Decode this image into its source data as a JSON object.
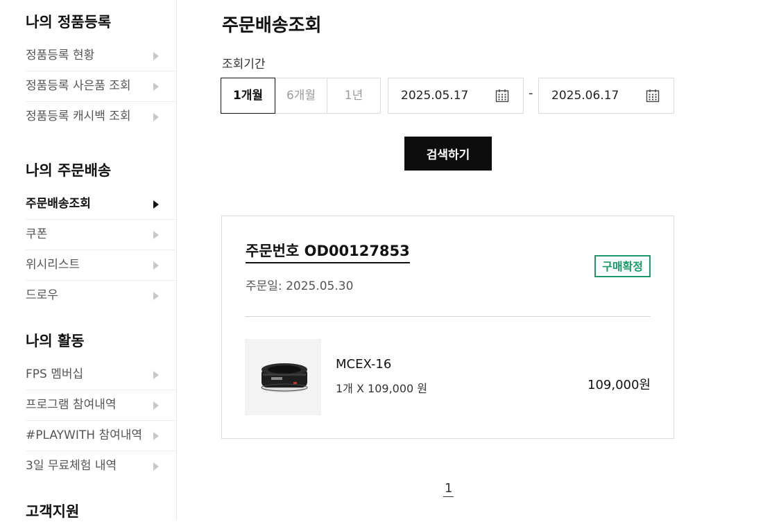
{
  "sidebar": {
    "sections": [
      {
        "heading": "나의 정품등록",
        "items": [
          {
            "label": "정품등록 현황"
          },
          {
            "label": "정품등록 사은품 조회"
          },
          {
            "label": "정품등록 캐시백 조회"
          }
        ]
      },
      {
        "heading": "나의 주문배송",
        "items": [
          {
            "label": "주문배송조회",
            "active": true
          },
          {
            "label": "쿠폰"
          },
          {
            "label": "위시리스트"
          },
          {
            "label": "드로우"
          }
        ]
      },
      {
        "heading": "나의 활동",
        "items": [
          {
            "label": "FPS 멤버십"
          },
          {
            "label": "프로그램 참여내역"
          },
          {
            "label": "#PLAYWITH 참여내역"
          },
          {
            "label": "3일 무료체험 내역"
          }
        ]
      },
      {
        "heading": "고객지원",
        "items": []
      }
    ]
  },
  "main": {
    "title": "주문배송조회",
    "period_label": "조회기간",
    "periods": [
      {
        "label": "1개월",
        "selected": true
      },
      {
        "label": "6개월"
      },
      {
        "label": "1년"
      }
    ],
    "date_from": "2025.05.17",
    "date_separator": "-",
    "date_to": "2025.06.17",
    "search_label": "검색하기",
    "order": {
      "number_label": "주문번호",
      "number": "OD00127853",
      "date_label": "주문일:",
      "date": "2025.05.30",
      "status": "구매확정",
      "status_color": "#179a67",
      "product": {
        "name": "MCEX-16",
        "qty": "1개 X 109,000 원",
        "price": "109,000원"
      }
    },
    "pagination": {
      "current": "1"
    }
  }
}
